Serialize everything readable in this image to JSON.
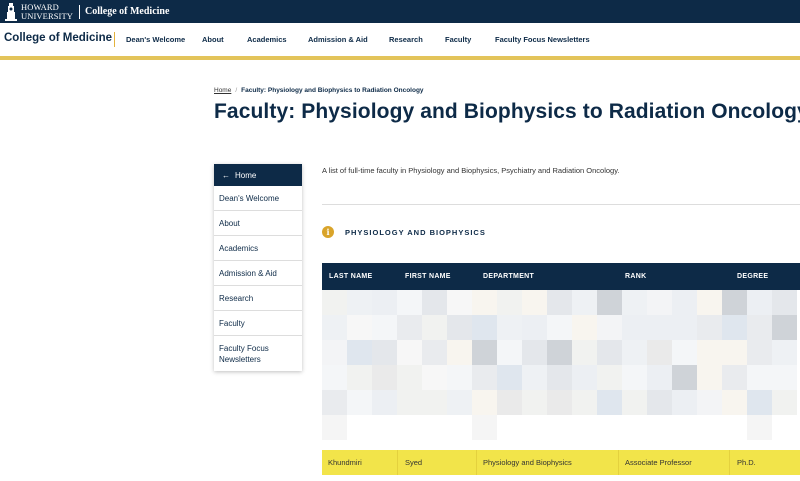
{
  "brand": {
    "university_line1": "HOWARD",
    "university_line2": "UNIVERSITY",
    "college": "College of Medicine",
    "bar_color": "#0d2a47"
  },
  "nav": {
    "site_title": "College of Medicine",
    "links": [
      "Dean's Welcome",
      "About",
      "Academics",
      "Admission & Aid",
      "Research",
      "Faculty",
      "Faculty Focus Newsletters"
    ],
    "accent_color": "#e3c45a"
  },
  "breadcrumb": {
    "home": "Home",
    "current": "Faculty: Physiology and Biophysics to Radiation Oncology"
  },
  "page": {
    "title": "Faculty: Physiology and Biophysics to Radiation Oncology",
    "intro": "A list of full-time faculty in Physiology and Biophysics, Psychiatry and Radiation Oncology."
  },
  "sidenav": {
    "home_label": "Home",
    "home_icon": "arrow-left-icon",
    "items": [
      "Dean's Welcome",
      "About",
      "Academics",
      "Admission & Aid",
      "Research",
      "Faculty",
      "Faculty Focus Newsletters"
    ]
  },
  "section": {
    "icon": "info-icon",
    "title": "PHYSIOLOGY AND BIOPHYSICS"
  },
  "table": {
    "headers": [
      "LAST NAME",
      "FIRST NAME",
      "DEPARTMENT",
      "RANK",
      "DEGREE"
    ],
    "highlighted_row": {
      "last_name": "Khundmiri",
      "first_name": "Syed",
      "department": "Physiology and Biophysics",
      "rank": "Associate Professor",
      "degree": "Ph.D.",
      "highlight_color": "#f2e44a"
    }
  }
}
